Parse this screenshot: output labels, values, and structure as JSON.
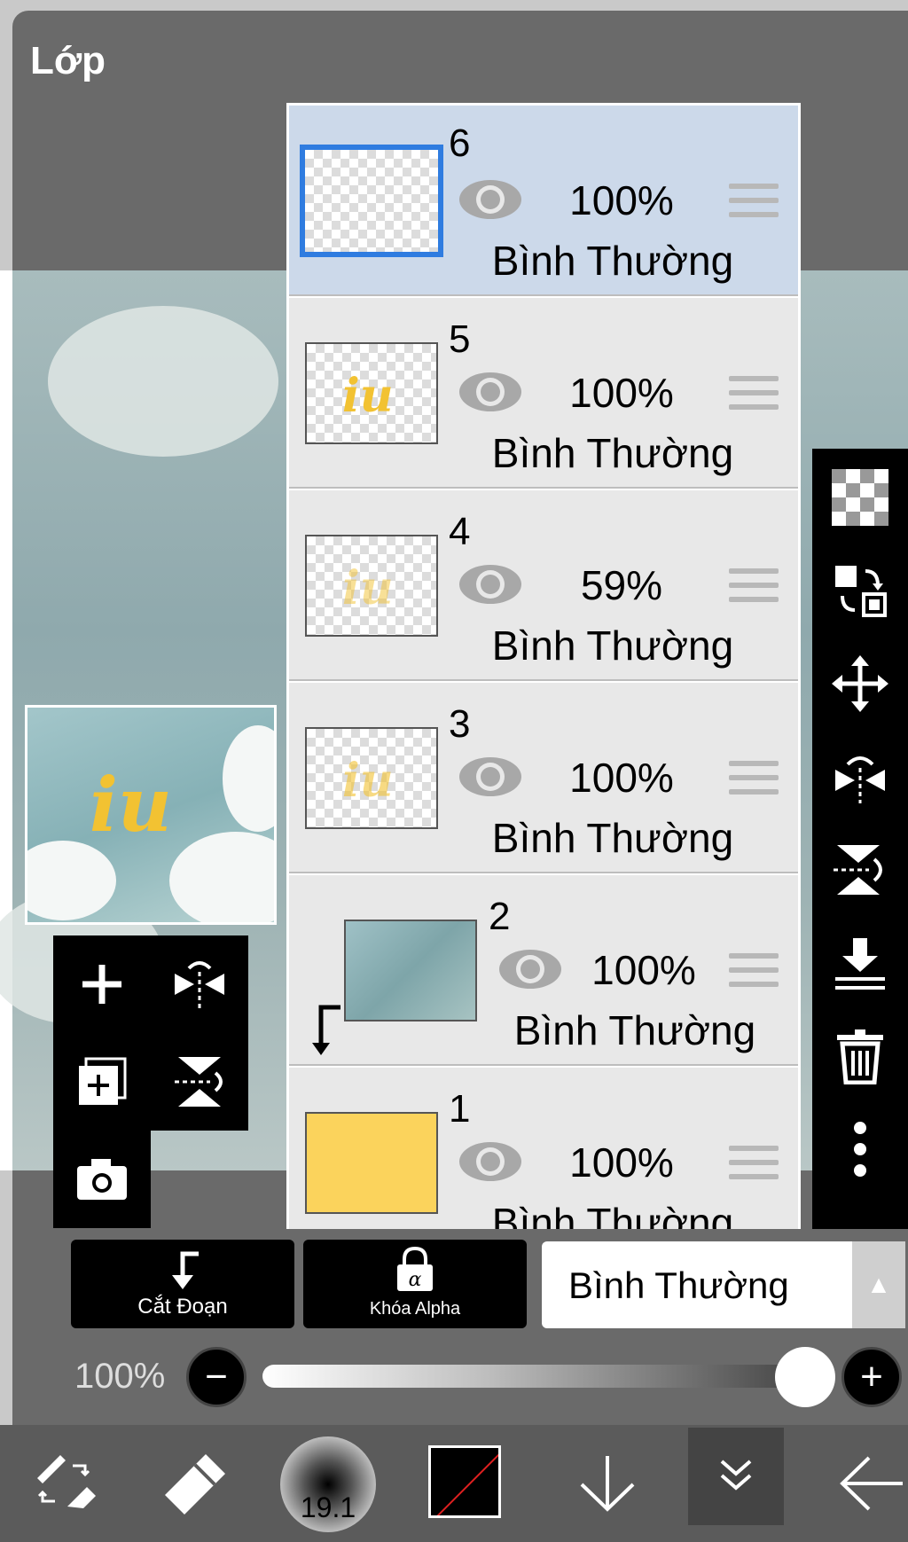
{
  "panel": {
    "title": "Lớp"
  },
  "layers": [
    {
      "number": "6",
      "opacity": "100%",
      "blend_mode": "Bình Thường",
      "selected": true
    },
    {
      "number": "5",
      "opacity": "100%",
      "blend_mode": "Bình Thường",
      "selected": false
    },
    {
      "number": "4",
      "opacity": "59%",
      "blend_mode": "Bình Thường",
      "selected": false
    },
    {
      "number": "3",
      "opacity": "100%",
      "blend_mode": "Bình Thường",
      "selected": false
    },
    {
      "number": "2",
      "opacity": "100%",
      "blend_mode": "Bình Thường",
      "selected": false,
      "clipping": true
    },
    {
      "number": "1",
      "opacity": "100%",
      "blend_mode": "Bình Thường",
      "selected": false
    }
  ],
  "layer_thumb_text": "iu",
  "preview_text": "iu",
  "buttons": {
    "clipping_label": "Cắt Đoạn",
    "alpha_lock_label": "Khóa Alpha",
    "blend_mode_value": "Bình Thường"
  },
  "opacity": {
    "label": "100%",
    "value": 1.0
  },
  "brush": {
    "size_label": "19.1"
  },
  "colors": {
    "selection_blue": "#2f7ce0",
    "selected_row": "#ccd9ea",
    "accent_yellow": "#f2c232"
  },
  "icons": {
    "left_tools": [
      "add-layer-icon",
      "flip-horizontal-icon",
      "copy-layer-icon",
      "flip-vertical-icon",
      "camera-icon"
    ],
    "right_tools": [
      "transparency-icon",
      "swap-layers-icon",
      "move-icon",
      "flip-horizontal-icon",
      "flip-vertical-icon",
      "merge-down-icon",
      "trash-icon",
      "more-icon"
    ],
    "bottom_bar": [
      "brush-switch-icon",
      "eraser-icon",
      "brush-size-icon",
      "color-icon",
      "arrow-down-icon",
      "chevron-double-down-icon",
      "back-arrow-icon"
    ]
  }
}
